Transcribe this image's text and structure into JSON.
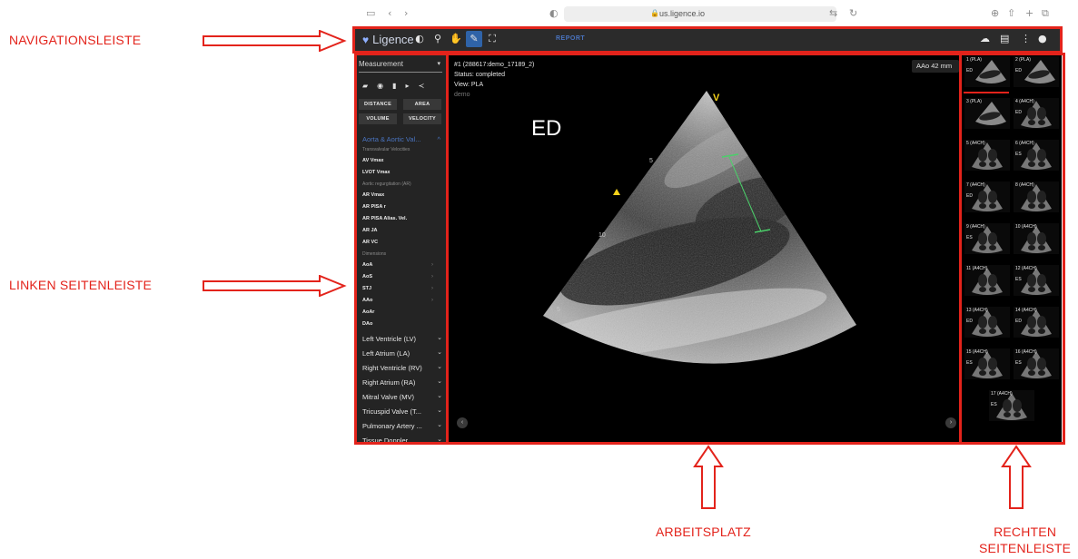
{
  "annotations": {
    "navigation": "NAVIGATIONSLEISTE",
    "left_sidebar": "LINKEN SEITENLEISTE",
    "workspace": "ARBEITSPLATZ",
    "right_sidebar_line1": "RECHTEN",
    "right_sidebar_line2": "SEITENLEISTE",
    "color": "#e3231b"
  },
  "browser": {
    "url": "us.ligence.io"
  },
  "nav": {
    "logo_text": "Ligence",
    "report_label": "REPORT",
    "tools": [
      "contrast-icon",
      "zoom-icon",
      "hand-icon",
      "measure-icon",
      "fullscreen-icon"
    ],
    "right_icons": [
      "cloud-icon",
      "document-icon",
      "more-vertical-icon",
      "account-icon"
    ]
  },
  "sidebar": {
    "mode": "Measurement",
    "buttons": [
      "DISTANCE",
      "AREA",
      "VOLUME",
      "VELOCITY"
    ],
    "section": "Aorta & Aortic Val...",
    "subs": {
      "transvalvular": "Transvalvular Velocities",
      "regurg": "Aortic regurgitation (AR)",
      "dimensions": "Dimensions"
    },
    "items": {
      "av_vmax": "AV Vmax",
      "lvot_vmax": "LVOT Vmax",
      "ar_vmax": "AR Vmax",
      "ar_pisa_r": "AR PISA r",
      "ar_pisa_alias": "AR PISA Alias. Vel.",
      "ar_ja": "AR JA",
      "ar_vc": "AR VC",
      "aoa": "AoA",
      "aos": "AoS",
      "stj": "STJ",
      "aao": "AAo",
      "aoar": "AoAr",
      "dao": "DAo"
    },
    "groups": [
      "Left Ventricle (LV)",
      "Left Atrium (LA)",
      "Right Ventricle (RV)",
      "Right Atrium (RA)",
      "Mitral Valve (MV)",
      "Tricuspid Valve (T...",
      "Pulmonary Artery ...",
      "Tissue Doppler"
    ]
  },
  "workspace": {
    "title": "#1 (288617:demo_17189_2)",
    "status": "Status: completed",
    "view": "View: PLA",
    "tag": "demo",
    "measure_box": "AAo 42 mm",
    "phase": "ED",
    "v_marker": "V",
    "depth_5a": "5",
    "depth_10": "10",
    "depth_5b": "5"
  },
  "thumbnails": [
    {
      "label": "1 (PLA)",
      "sub": "ED"
    },
    {
      "label": "2 (PLA)",
      "sub": "ED"
    },
    {
      "label": "3 (PLA)",
      "sub": ""
    },
    {
      "label": "4 (A4CH)",
      "sub": "ED"
    },
    {
      "label": "5 (A4CH)",
      "sub": ""
    },
    {
      "label": "6 (A4CH)",
      "sub": "ES"
    },
    {
      "label": "7 (A4CH)",
      "sub": "ED"
    },
    {
      "label": "8 (A4CH)",
      "sub": ""
    },
    {
      "label": "9 (A4CH)",
      "sub": "ES"
    },
    {
      "label": "10 (A4CH)",
      "sub": ""
    },
    {
      "label": "11 (A4CH)",
      "sub": ""
    },
    {
      "label": "12 (A4CH)",
      "sub": "ES"
    },
    {
      "label": "13 (A4CH)",
      "sub": "ED"
    },
    {
      "label": "14 (A4CH)",
      "sub": "ED"
    },
    {
      "label": "15 (A4CH)",
      "sub": "ES"
    },
    {
      "label": "16 (A4CH)",
      "sub": "ES"
    },
    {
      "label": "17 (A4CH)",
      "sub": "ES"
    }
  ]
}
